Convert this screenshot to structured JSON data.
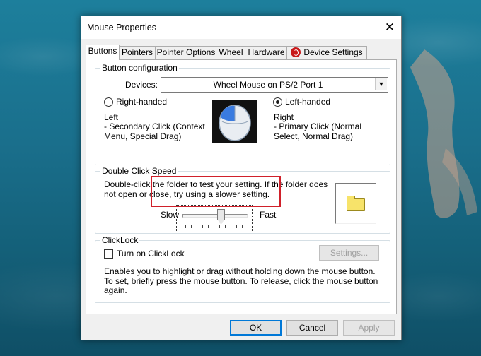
{
  "window": {
    "title": "Mouse Properties",
    "close_glyph": "✕"
  },
  "tabs": [
    {
      "label": "Buttons"
    },
    {
      "label": "Pointers"
    },
    {
      "label": "Pointer Options"
    },
    {
      "label": "Wheel"
    },
    {
      "label": "Hardware"
    },
    {
      "label": "Device Settings"
    }
  ],
  "active_tab": "Buttons",
  "button_configuration": {
    "group_label": "Button configuration",
    "devices_label": "Devices:",
    "devices_value": "Wheel Mouse on PS/2 Port 1",
    "right_handed_label": "Right-handed",
    "left_handed_label": "Left-handed",
    "right_handed_selected": false,
    "left_handed_selected": true,
    "left_title": "Left",
    "left_desc": "- Secondary Click (Context Menu, Special Drag)",
    "right_title": "Right",
    "right_desc": "- Primary Click (Normal Select, Normal Drag)"
  },
  "double_click": {
    "group_label": "Double Click Speed",
    "description": "Double-click the folder to test your setting.  If the folder does not open or close, try using a slower setting.",
    "slow_label": "Slow",
    "fast_label": "Fast",
    "speed_fraction": 0.6
  },
  "clicklock": {
    "group_label": "ClickLock",
    "checkbox_label": "Turn on ClickLock",
    "checked": false,
    "settings_button": "Settings...",
    "description": "Enables you to highlight or drag without holding down the mouse button.  To set, briefly press the mouse button.  To release, click the mouse button again."
  },
  "footer": {
    "ok": "OK",
    "cancel": "Cancel",
    "apply": "Apply"
  },
  "colors": {
    "highlight_box": "#d0202a",
    "accent": "#0078d7",
    "background_water": "#1a6f8c"
  }
}
